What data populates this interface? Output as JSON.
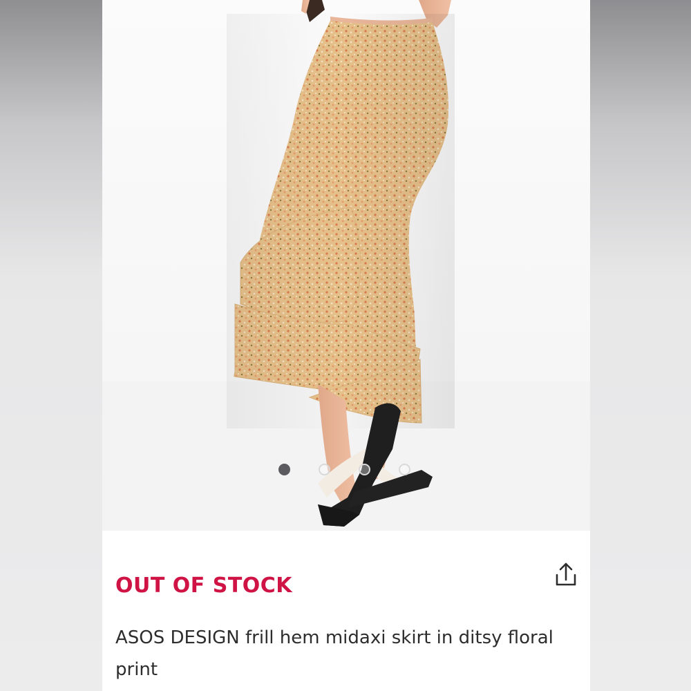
{
  "product": {
    "image_alt": "Model wearing floral frill hem midaxi skirt with black flatform sandals",
    "stock_status": "OUT OF STOCK",
    "title": "ASOS DESIGN frill hem midaxi skirt in ditsy floral print"
  },
  "carousel": {
    "total_slides": 4,
    "active_index": 0
  },
  "icons": {
    "share": "share-icon"
  },
  "colors": {
    "out_of_stock": "#d01345",
    "title_text": "#2d2d2d",
    "active_dot": "#5b5b5f",
    "skirt_base": "#e8c28a"
  }
}
